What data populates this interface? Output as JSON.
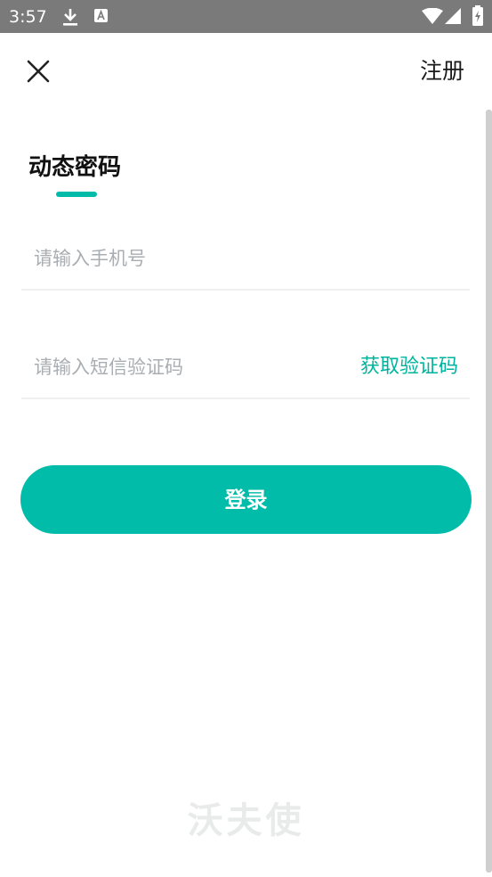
{
  "status_bar": {
    "time": "3:57",
    "icons": [
      "download-icon",
      "a-badge-icon",
      "wifi-icon",
      "signal-icon",
      "battery-icon"
    ],
    "background": "#7a7a7a"
  },
  "header": {
    "close_icon": "close-icon",
    "register_label": "注册"
  },
  "tab": {
    "title": "动态密码",
    "indicator_color": "#00bba8"
  },
  "form": {
    "phone": {
      "placeholder": "请输入手机号",
      "value": ""
    },
    "code": {
      "placeholder": "请输入短信验证码",
      "value": "",
      "get_code_label": "获取验证码"
    },
    "login_label": "登录"
  },
  "watermark": {
    "text": "沃夫使"
  },
  "colors": {
    "accent": "#00bca9",
    "link": "#00b39d",
    "placeholder": "#a9aeb3",
    "divider": "#f0f0f0"
  }
}
